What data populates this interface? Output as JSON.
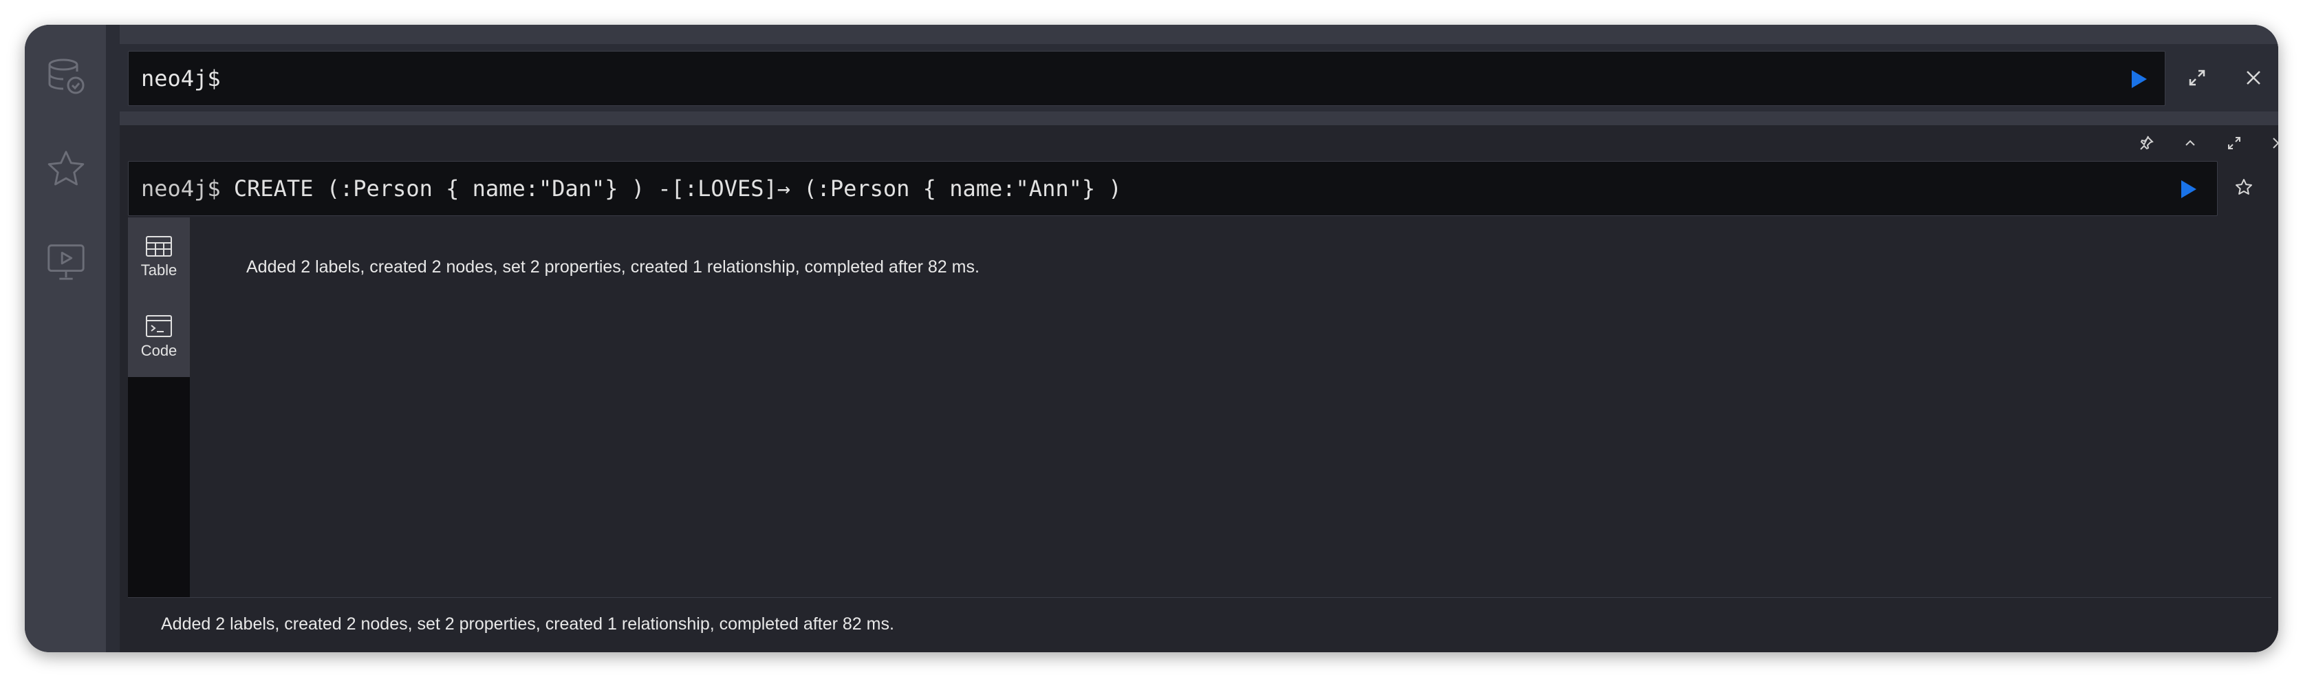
{
  "editor": {
    "prompt": "neo4j$"
  },
  "frame": {
    "command_prompt": "neo4j$",
    "command": "CREATE (:Person { name:\"Dan\"} ) -[:LOVES]→ (:Person { name:\"Ann\"} )",
    "views": [
      {
        "label": "Table",
        "icon": "table-icon"
      },
      {
        "label": "Code",
        "icon": "code-icon"
      }
    ],
    "result_message": "Added 2 labels, created 2 nodes, set 2 properties, created 1 relationship, completed after 82 ms.",
    "footer_message": "Added 2 labels, created 2 nodes, set 2 properties, created 1 relationship, completed after 82 ms."
  },
  "sidebar": {
    "items": [
      {
        "icon": "database-icon"
      },
      {
        "icon": "star-icon"
      },
      {
        "icon": "monitor-play-icon"
      }
    ]
  },
  "colors": {
    "accent": "#1a73e8",
    "background": "#2b2d36",
    "sidebar": "#3d3f49",
    "editor": "#0f1013"
  }
}
